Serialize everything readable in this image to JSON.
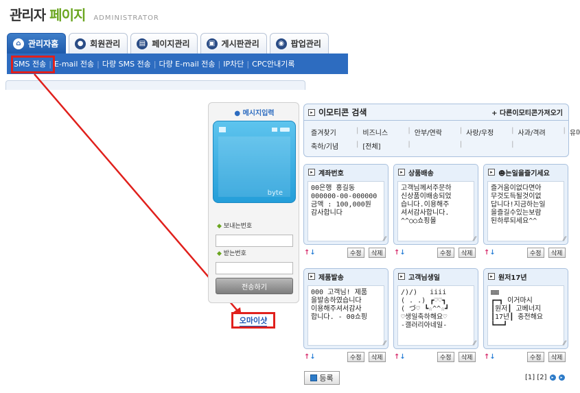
{
  "header": {
    "title_main": "관리자",
    "title_accent": "페이지",
    "title_sub": "ADMINISTRATOR"
  },
  "tabs": [
    {
      "label": "관리자홈",
      "icon": "home-icon",
      "active": true
    },
    {
      "label": "회원관리",
      "icon": "user-icon",
      "active": false
    },
    {
      "label": "페이지관리",
      "icon": "page-icon",
      "active": false
    },
    {
      "label": "게시판관리",
      "icon": "board-icon",
      "active": false
    },
    {
      "label": "팝업관리",
      "icon": "popup-icon",
      "active": false
    }
  ],
  "subnav": [
    "SMS 전송",
    "E-mail 전송",
    "다량 SMS 전송",
    "다량 E-mail 전송",
    "IP차단",
    "CPC안내기록"
  ],
  "phone": {
    "title": "메시지입력",
    "byte_label": "byte",
    "sender_label": "보내는번호",
    "receiver_label": "받는번호",
    "send_button": "전송하기",
    "emoticon_button": "오마이샷"
  },
  "search": {
    "title": "이모티콘 검색",
    "more_link": "+ 다른이모티콘가져오기",
    "categories_row1": [
      "즐겨찾기",
      "비즈니스",
      "안부/연락",
      "사랑/우정",
      "사과/격려",
      "유머"
    ],
    "categories_row2": [
      "축하/기념",
      "[전체]"
    ]
  },
  "cards": [
    {
      "title": "계좌번호",
      "body": "00은행 홍길동\n000000-00-000000\n금액 : 100,000원\n감사합니다"
    },
    {
      "title": "상품배송",
      "body": "고객님께서주문하\n신상품이배송되었\n습니다.이용해주\n셔서감사합니다.\n^^○○쇼핑몰"
    },
    {
      "title": "☻는일을즐기세요",
      "body": "즐거움이없다면아\n무것도득될것이없\n답니다!지금하는일\n을즐길수있는보람\n된하루되세요^^"
    },
    {
      "title": "제품발송",
      "body": "000 고객님! 제품\n을발송하였습니다\n이용해주셔서감사\n합니다. - 00쇼핑"
    },
    {
      "title": "고객님생일",
      "body": "/)/)   iiii\n( . .) ┏♡♡┓\n( づ♡ ┗☆^^☆┛\n♡생일축하해요♡\n-갤러리아네일-"
    },
    {
      "title": "원저17년",
      "body": "▥▥\n┏━┓ 이거마시\n┃원저┃ 고베너지\n┃17년┃ 충전해요\n┗━━┛"
    }
  ],
  "card_buttons": {
    "edit": "수정",
    "delete": "삭제",
    "up": "↑",
    "down": "↓"
  },
  "register_button": "등록",
  "pager": {
    "pages": "[1] [2]"
  },
  "colors": {
    "accent_blue": "#2d6cc0",
    "highlight_red": "#e0201c",
    "title_green": "#6aa51f"
  }
}
